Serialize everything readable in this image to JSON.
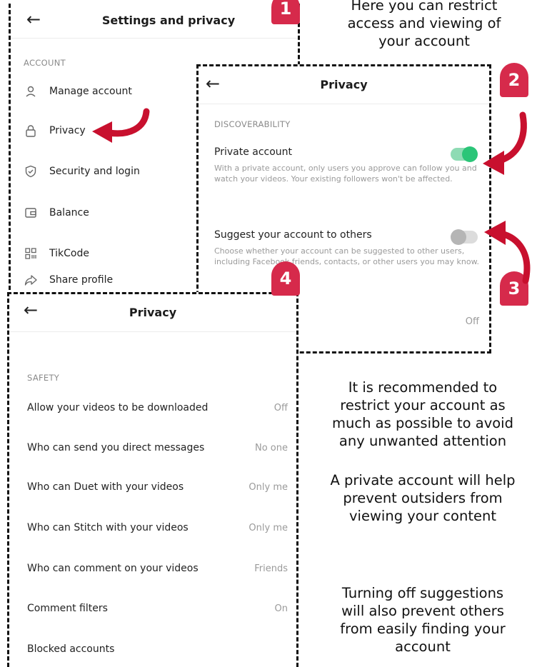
{
  "panel1": {
    "title": "Settings and privacy",
    "section": "ACCOUNT",
    "items": [
      {
        "label": "Manage account",
        "icon": "person-icon"
      },
      {
        "label": "Privacy",
        "icon": "lock-icon"
      },
      {
        "label": "Security and login",
        "icon": "shield-icon"
      },
      {
        "label": "Balance",
        "icon": "wallet-icon"
      },
      {
        "label": "TikCode",
        "icon": "qrcode-icon"
      },
      {
        "label": "Share profile",
        "icon": "share-icon"
      }
    ]
  },
  "panel2": {
    "title": "Privacy",
    "section": "DISCOVERABILITY",
    "private_title": "Private account",
    "private_desc": "With a private account, only users you approve can follow you and watch your videos. Your existing followers won't be affected.",
    "private_on": true,
    "suggest_title": "Suggest your account to others",
    "suggest_desc": "Choose whether your account can be suggested to other users, including Facebook friends, contacts, or other users you may know.",
    "suggest_on": false,
    "bottom_value": "Off"
  },
  "panel3": {
    "title": "Privacy",
    "section": "SAFETY",
    "rows": [
      {
        "label": "Allow your videos to be downloaded",
        "value": "Off"
      },
      {
        "label": "Who can send you direct messages",
        "value": "No one"
      },
      {
        "label": "Who can Duet with your videos",
        "value": "Only me"
      },
      {
        "label": "Who can Stitch with your videos",
        "value": "Only me"
      },
      {
        "label": "Who can comment on your videos",
        "value": "Friends"
      },
      {
        "label": "Comment filters",
        "value": "On"
      },
      {
        "label": "Blocked accounts",
        "value": ""
      }
    ]
  },
  "badges": [
    "1",
    "2",
    "3",
    "4"
  ],
  "notes": {
    "top": [
      "Here you can restrict",
      "access and viewing of",
      "your account"
    ],
    "p1": [
      "It is recommended to",
      "restrict your account as",
      "much as possible to avoid",
      "any unwanted attention"
    ],
    "p2": [
      "A private account will help",
      "prevent outsiders from",
      "viewing your content"
    ],
    "p3": [
      "Turning off suggestions",
      "will also prevent others",
      "from easily finding your",
      "account"
    ]
  },
  "colors": {
    "accent_red": "#d62a4b",
    "arrow_red": "#c8102e",
    "toggle_on": "#2bc578",
    "toggle_off": "#c9c9c9"
  }
}
